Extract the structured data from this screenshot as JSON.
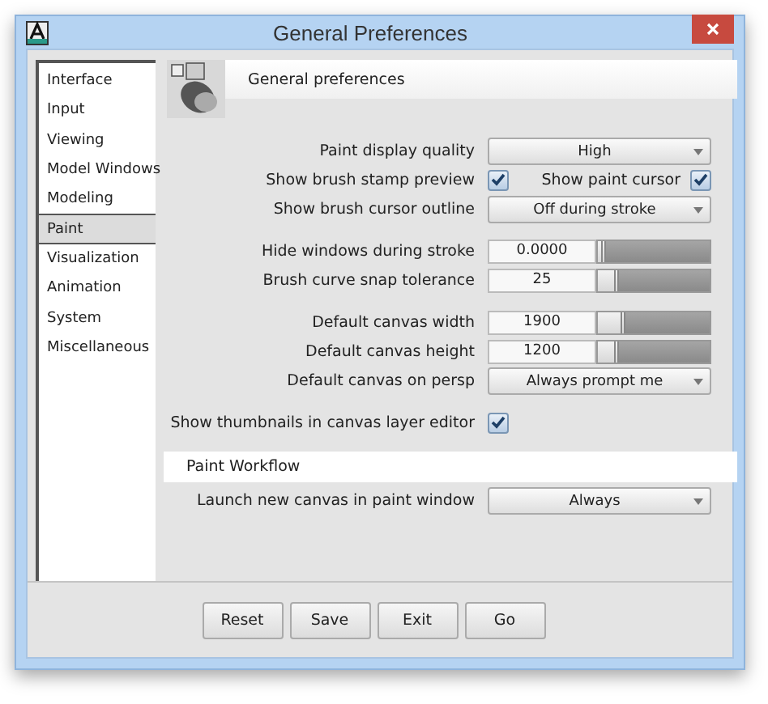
{
  "window": {
    "title": "General Preferences"
  },
  "sidebar": {
    "items": [
      {
        "label": "Interface",
        "selected": false
      },
      {
        "label": "Input",
        "selected": false
      },
      {
        "label": "Viewing",
        "selected": false
      },
      {
        "label": "Model Windows",
        "selected": false
      },
      {
        "label": "Modeling",
        "selected": false
      },
      {
        "label": "Paint",
        "selected": true
      },
      {
        "label": "Visualization",
        "selected": false
      },
      {
        "label": "Animation",
        "selected": false
      },
      {
        "label": "System",
        "selected": false
      },
      {
        "label": "Miscellaneous",
        "selected": false
      }
    ]
  },
  "header": {
    "title": "General preferences"
  },
  "groups": [
    {
      "rows": [
        {
          "kind": "dropdown",
          "label": "Paint display quality",
          "value": "High"
        },
        {
          "kind": "checkbox",
          "label": "Show brush stamp preview",
          "checked": true,
          "extra": {
            "label": "Show paint cursor",
            "checked": true
          }
        },
        {
          "kind": "dropdown",
          "label": "Show brush cursor outline",
          "value": "Off during stroke"
        }
      ]
    },
    {
      "rows": [
        {
          "kind": "slider",
          "label": "Hide windows during stroke",
          "value": "0.0000",
          "level": 0.03
        },
        {
          "kind": "slider",
          "label": "Brush curve snap tolerance",
          "value": "25",
          "level": 0.15
        }
      ]
    },
    {
      "rows": [
        {
          "kind": "slider",
          "label": "Default canvas width",
          "value": "1900",
          "level": 0.2
        },
        {
          "kind": "slider",
          "label": "Default canvas height",
          "value": "1200",
          "level": 0.15
        },
        {
          "kind": "dropdown",
          "label": "Default canvas on persp",
          "value": "Always prompt me"
        }
      ]
    },
    {
      "rows": [
        {
          "kind": "checkbox",
          "label": "Show thumbnails in canvas layer editor",
          "checked": true
        }
      ]
    }
  ],
  "workflow": {
    "title": "Paint Workflow",
    "rows": [
      {
        "kind": "dropdown",
        "label": "Launch new canvas in paint window",
        "value": "Always"
      }
    ]
  },
  "buttons": [
    "Reset",
    "Save",
    "Exit",
    "Go"
  ]
}
